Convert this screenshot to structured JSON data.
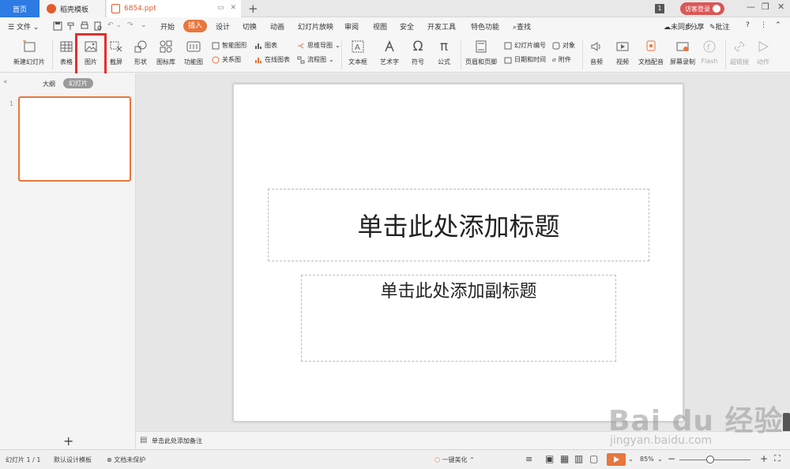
{
  "tabs": {
    "home": "首页",
    "template": "稻壳模板",
    "document": "6854.ppt",
    "page_count_badge": "1",
    "guest_login": "访客登录"
  },
  "menu": {
    "file": "文件",
    "items": [
      "开始",
      "插入",
      "设计",
      "切换",
      "动画",
      "幻灯片放映",
      "审阅",
      "视图",
      "安全",
      "开发工具",
      "特色功能"
    ],
    "search": "查找",
    "right": {
      "sync": "未同步",
      "share": "分享",
      "comment": "批注"
    }
  },
  "ribbon": {
    "new_slide": "新建幻灯片",
    "table": "表格",
    "picture": "图片",
    "screenshot": "截屏",
    "shape": "形状",
    "icon_library": "图标库",
    "function_chart": "功能图",
    "smart_art": "智能图形",
    "chart": "图表",
    "relation_chart": "关系图",
    "online_chart": "在线图表",
    "mind_map": "思维导图",
    "flow_chart": "流程图",
    "text_box": "文本框",
    "art_text": "艺术字",
    "symbol": "符号",
    "formula": "公式",
    "header_footer": "页眉和页脚",
    "slide_number": "幻灯片编号",
    "object": "对象",
    "date_time": "日期和时间",
    "attachment": "附件",
    "audio": "音频",
    "video": "视频",
    "doc_dub": "文档配音",
    "screen_record": "屏幕录制",
    "flash": "Flash",
    "hyperlink": "超链接",
    "action": "动作"
  },
  "left_panel": {
    "outline": "大纲",
    "slides": "幻灯片",
    "slide_index": "1",
    "add": "+"
  },
  "slide": {
    "title_placeholder": "单击此处添加标题",
    "subtitle_placeholder": "单击此处添加副标题"
  },
  "notes": {
    "placeholder": "单击此处添加备注"
  },
  "status": {
    "slide_count": "幻灯片 1 / 1",
    "design_template": "默认设计模板",
    "protection": "文档未保护",
    "beautify": "一键美化",
    "zoom": "85%"
  },
  "watermark": {
    "brand": "Bai du 经验",
    "url": "jingyan.baidu.com"
  },
  "colors": {
    "accent": "#e8763d",
    "home_tab": "#2d7be3",
    "login": "#d95757",
    "highlight": "#e03030"
  }
}
